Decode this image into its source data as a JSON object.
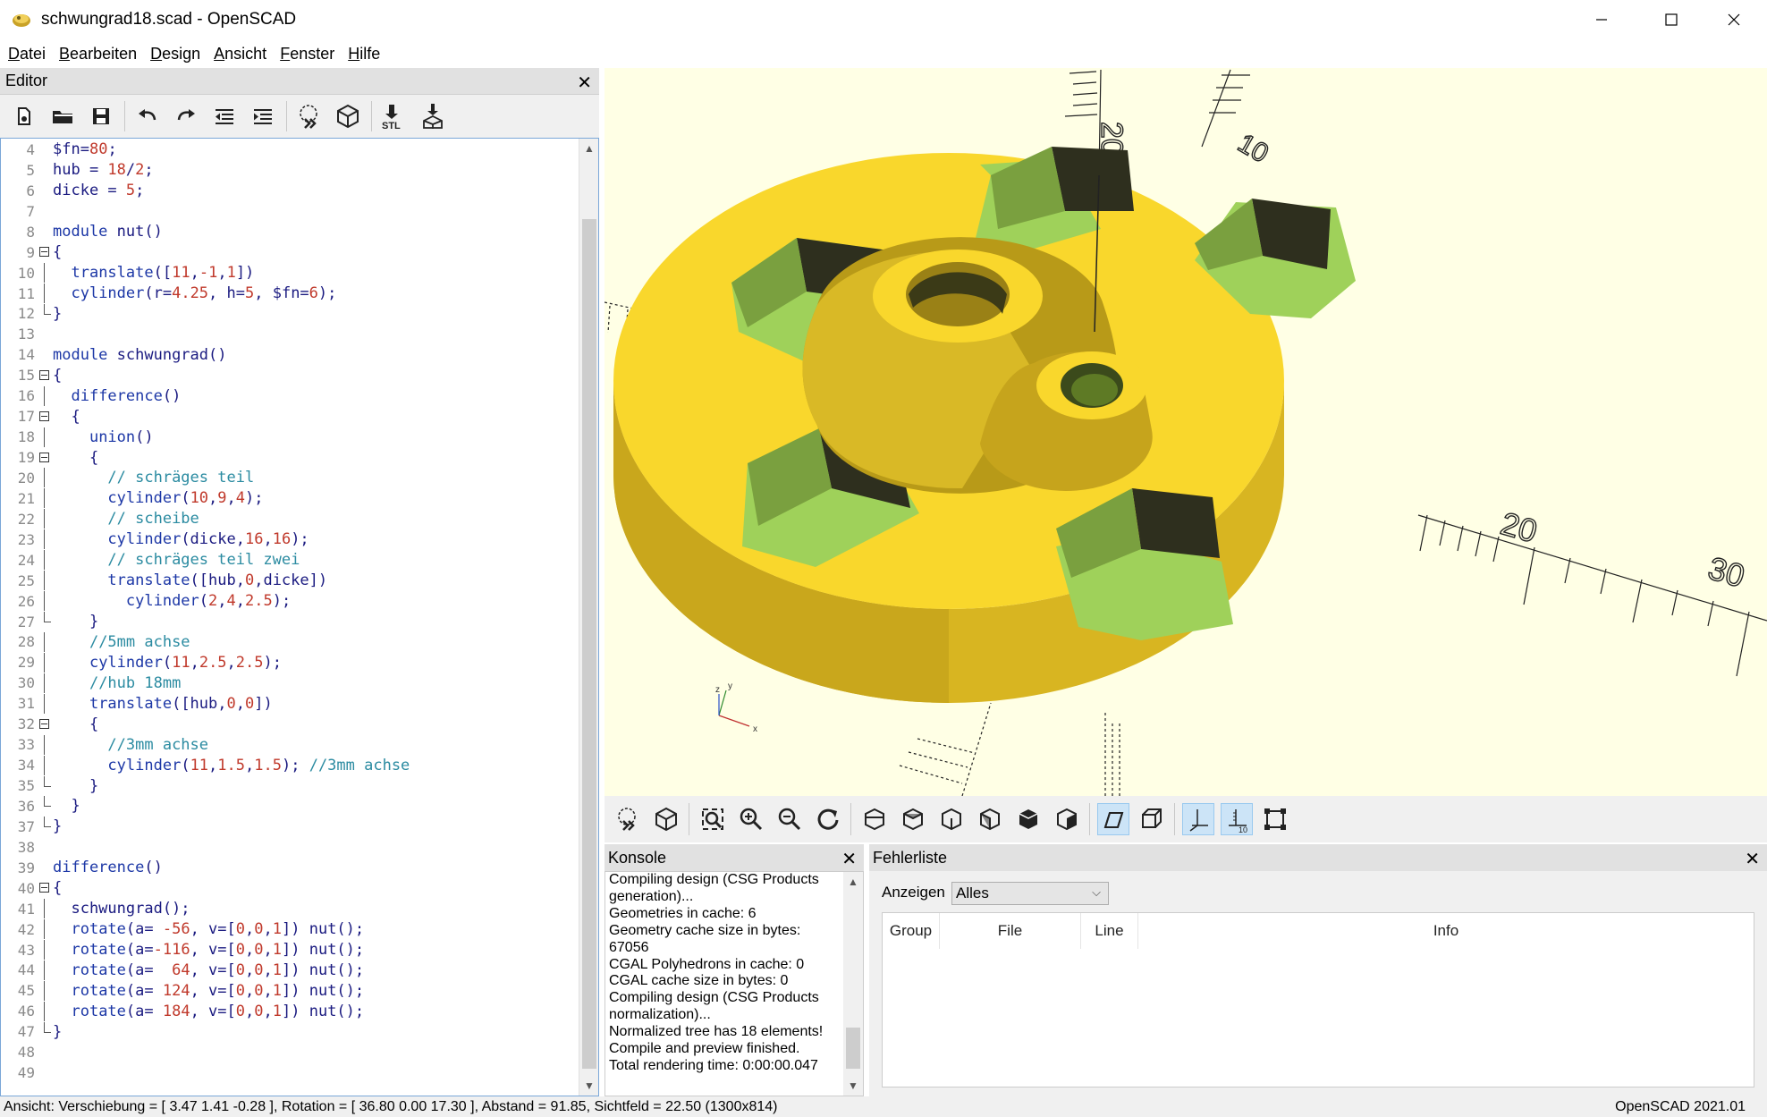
{
  "window": {
    "title": "schwungrad18.scad - OpenSCAD",
    "minimize_icon": "minimize-icon",
    "maximize_icon": "maximize-icon",
    "close_icon": "close-icon"
  },
  "menu": [
    "Datei",
    "Bearbeiten",
    "Design",
    "Ansicht",
    "Fenster",
    "Hilfe"
  ],
  "menu_underline": [
    "D",
    "B",
    "D",
    "A",
    "F",
    "H"
  ],
  "editor": {
    "title": "Editor",
    "toolbar_icons": [
      "new-file-icon",
      "open-folder-icon",
      "save-icon",
      "undo-icon",
      "redo-icon",
      "unindent-icon",
      "indent-icon",
      "preview-icon",
      "render-icon",
      "export-stl-icon",
      "send-to-3d-print-icon"
    ],
    "stl_label": "STL",
    "lines": [
      {
        "n": "4",
        "t": "$fn=80;"
      },
      {
        "n": "5",
        "t": "hub = 18/2;"
      },
      {
        "n": "6",
        "t": "dicke = 5;"
      },
      {
        "n": "7",
        "t": ""
      },
      {
        "n": "8",
        "t": "module nut()"
      },
      {
        "n": "9",
        "t": "{"
      },
      {
        "n": "10",
        "t": "  translate([11,-1,1])"
      },
      {
        "n": "11",
        "t": "  cylinder(r=4.25, h=5, $fn=6);"
      },
      {
        "n": "12",
        "t": "}"
      },
      {
        "n": "13",
        "t": ""
      },
      {
        "n": "14",
        "t": "module schwungrad()"
      },
      {
        "n": "15",
        "t": "{"
      },
      {
        "n": "16",
        "t": "  difference()"
      },
      {
        "n": "17",
        "t": "  {"
      },
      {
        "n": "18",
        "t": "    union()"
      },
      {
        "n": "19",
        "t": "    {"
      },
      {
        "n": "20",
        "t": "      // schräges teil"
      },
      {
        "n": "21",
        "t": "      cylinder(10,9,4);"
      },
      {
        "n": "22",
        "t": "      // scheibe"
      },
      {
        "n": "23",
        "t": "      cylinder(dicke,16,16);"
      },
      {
        "n": "24",
        "t": "      // schräges teil zwei"
      },
      {
        "n": "25",
        "t": "      translate([hub,0,dicke])"
      },
      {
        "n": "26",
        "t": "        cylinder(2,4,2.5);"
      },
      {
        "n": "27",
        "t": "    }"
      },
      {
        "n": "28",
        "t": "    //5mm achse"
      },
      {
        "n": "29",
        "t": "    cylinder(11,2.5,2.5);"
      },
      {
        "n": "30",
        "t": "    //hub 18mm"
      },
      {
        "n": "31",
        "t": "    translate([hub,0,0])"
      },
      {
        "n": "32",
        "t": "    {"
      },
      {
        "n": "33",
        "t": "      //3mm achse"
      },
      {
        "n": "34",
        "t": "      cylinder(11,1.5,1.5); //3mm achse"
      },
      {
        "n": "35",
        "t": "    }"
      },
      {
        "n": "36",
        "t": "  }"
      },
      {
        "n": "37",
        "t": "}"
      },
      {
        "n": "38",
        "t": ""
      },
      {
        "n": "39",
        "t": "difference()"
      },
      {
        "n": "40",
        "t": "{"
      },
      {
        "n": "41",
        "t": "  schwungrad();"
      },
      {
        "n": "42",
        "t": "  rotate(a= -56, v=[0,0,1]) nut();"
      },
      {
        "n": "43",
        "t": "  rotate(a=-116, v=[0,0,1]) nut();"
      },
      {
        "n": "44",
        "t": "  rotate(a=  64, v=[0,0,1]) nut();"
      },
      {
        "n": "45",
        "t": "  rotate(a= 124, v=[0,0,1]) nut();"
      },
      {
        "n": "46",
        "t": "  rotate(a= 184, v=[0,0,1]) nut();"
      },
      {
        "n": "47",
        "t": "}"
      },
      {
        "n": "48",
        "t": ""
      },
      {
        "n": "49",
        "t": ""
      }
    ]
  },
  "viewport": {
    "background": "#ffffe5",
    "model_color": "#f9d72c",
    "pocket_color": "#9fd15a",
    "axis_labels": [
      "20",
      "20",
      "20",
      "30",
      "10",
      "10"
    ],
    "axes_gizmo": {
      "x": "x",
      "y": "y",
      "z": "z"
    }
  },
  "view_toolbar": {
    "icons": [
      "preview-icon",
      "render-icon",
      "view-all-icon",
      "zoom-in-icon",
      "zoom-out-icon",
      "reset-view-icon",
      "view-right-icon",
      "view-top-icon",
      "view-bottom-icon",
      "view-left-icon",
      "view-front-icon",
      "view-back-icon",
      "perspective-icon",
      "orthogonal-icon",
      "show-axes-icon",
      "show-scale-markers-icon",
      "show-edges-icon"
    ],
    "active": [
      "perspective-icon",
      "show-axes-icon",
      "show-scale-markers-icon"
    ]
  },
  "console": {
    "title": "Konsole",
    "lines": [
      "Compiling design (CSG Products",
      "generation)...",
      "Geometries in cache: 6",
      "Geometry cache size in bytes:",
      "67056",
      "CGAL Polyhedrons in cache: 0",
      "CGAL cache size in bytes: 0",
      "Compiling design (CSG Products",
      "normalization)...",
      "Normalized tree has 18 elements!",
      "Compile and preview finished.",
      "Total rendering time: 0:00:00.047"
    ]
  },
  "errors": {
    "title": "Fehlerliste",
    "filter_label": "Anzeigen",
    "filter_value": "Alles",
    "columns": [
      "Group",
      "File",
      "Line",
      "Info"
    ]
  },
  "status": {
    "left": "Ansicht: Verschiebung = [ 3.47 1.41 -0.28 ], Rotation = [ 36.80 0.00 17.30 ], Abstand = 91.85, Sichtfeld = 22.50 (1300x814)",
    "right": "OpenSCAD 2021.01"
  }
}
